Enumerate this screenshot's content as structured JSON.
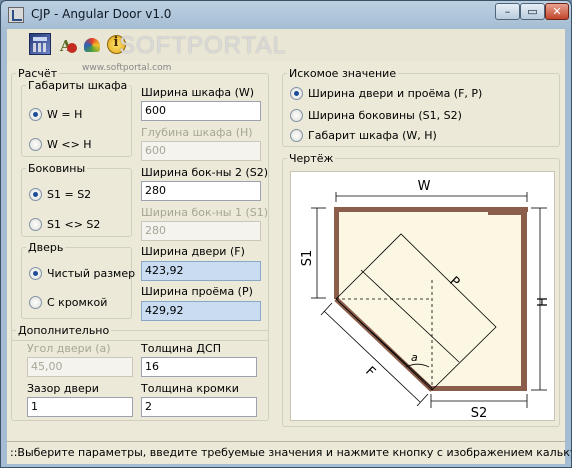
{
  "window": {
    "title": "CJP - Angular Door v1.0",
    "controls": {
      "minimize": "–",
      "maximize": "▭",
      "close": "✕"
    }
  },
  "toolbar": {
    "watermark": "SOFTPORTAL",
    "watermark_url": "www.softportal.com",
    "buttons": [
      {
        "name": "calculator-icon"
      },
      {
        "name": "tools-icon",
        "glyph": "A"
      },
      {
        "name": "color-palette-icon"
      },
      {
        "name": "info-icon",
        "glyph": "i"
      }
    ]
  },
  "calc": {
    "group_label": "Расчёт",
    "dimensions": {
      "label": "Габариты шкафа",
      "option_equal": "W  =  H",
      "option_notequal": "W <> H",
      "selected": "equal"
    },
    "sides": {
      "label": "Боковины",
      "option_equal": "S1 = S2",
      "option_notequal": "S1 <> S2",
      "selected": "equal"
    },
    "door": {
      "label": "Дверь",
      "option_clean": "Чистый размер",
      "option_edge": "С кромкой",
      "selected": "clean"
    },
    "fields": {
      "cabinet_width_label": "Ширина шкафа (W)",
      "cabinet_width": "600",
      "cabinet_depth_label": "Глубина шкафа (H)",
      "cabinet_depth": "600",
      "side2_width_label": "Ширина бок-ны 2 (S2)",
      "side2_width": "280",
      "side1_width_label": "Ширина бок-ны 1 (S1)",
      "side1_width": "280",
      "door_width_label": "Ширина двери (F)",
      "door_width": "423,92",
      "opening_width_label": "Ширина проёма (P)",
      "opening_width": "429,92"
    },
    "extra": {
      "label": "Дополнительно",
      "door_angle_label": "Угол двери (а)",
      "door_angle": "45,00",
      "board_thickness_label": "Толщина ДСП",
      "board_thickness": "16",
      "door_gap_label": "Зазор двери",
      "door_gap": "1",
      "edge_thickness_label": "Толщина кромки",
      "edge_thickness": "2"
    }
  },
  "target": {
    "label": "Искомое значение",
    "options": [
      "Ширина двери и проёма (F, P)",
      "Ширина боковины (S1, S2)",
      "Габарит шкафа (W, H)"
    ],
    "selected_index": 0
  },
  "drawing": {
    "label": "Чертёж",
    "labels": {
      "w": "W",
      "h": "H",
      "s1": "S1",
      "s2": "S2",
      "p": "P",
      "f": "F",
      "a": "a"
    },
    "colors": {
      "panel": "#8b5e4b",
      "fill": "#fbf7e2",
      "line": "#000000"
    }
  },
  "status": {
    "text": "::Выберите параметры, введите требуемые значения и нажмите кнопку с изображением калькулятора"
  }
}
